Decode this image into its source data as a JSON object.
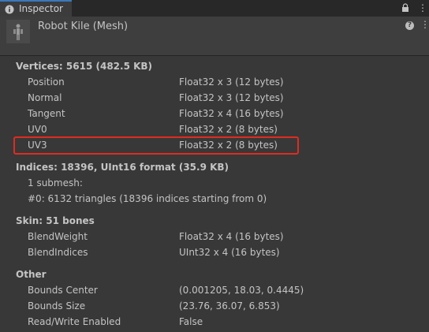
{
  "tab": {
    "label": "Inspector"
  },
  "header": {
    "title": "Robot Kile (Mesh)"
  },
  "sections": [
    {
      "title": "Vertices: 5615 (482.5 KB)",
      "rows": [
        {
          "label": "Position",
          "value": "Float32 x 3 (12 bytes)"
        },
        {
          "label": "Normal",
          "value": "Float32 x 3 (12 bytes)"
        },
        {
          "label": "Tangent",
          "value": "Float32 x 4 (16 bytes)"
        },
        {
          "label": "UV0",
          "value": "Float32 x 2 (8 bytes)"
        },
        {
          "label": "UV3",
          "value": "Float32 x 2 (8 bytes)"
        }
      ]
    },
    {
      "title": "Indices: 18396, UInt16 format (35.9 KB)",
      "lines": [
        "1 submesh:",
        "#0: 6132 triangles (18396 indices starting from 0)"
      ]
    },
    {
      "title": "Skin: 51 bones",
      "rows": [
        {
          "label": "BlendWeight",
          "value": "Float32 x 4 (16 bytes)"
        },
        {
          "label": "BlendIndices",
          "value": "UInt32 x 4 (16 bytes)"
        }
      ]
    },
    {
      "title": "Other",
      "rows": [
        {
          "label": "Bounds Center",
          "value": "(0.001205, 18.03, 0.4445)"
        },
        {
          "label": "Bounds Size",
          "value": "(23.76, 36.07, 6.853)"
        },
        {
          "label": "Read/Write Enabled",
          "value": "False"
        }
      ]
    }
  ],
  "colors": {
    "highlight": "#e02b20",
    "tab_accent": "#3a79bb",
    "background": "#383838"
  }
}
